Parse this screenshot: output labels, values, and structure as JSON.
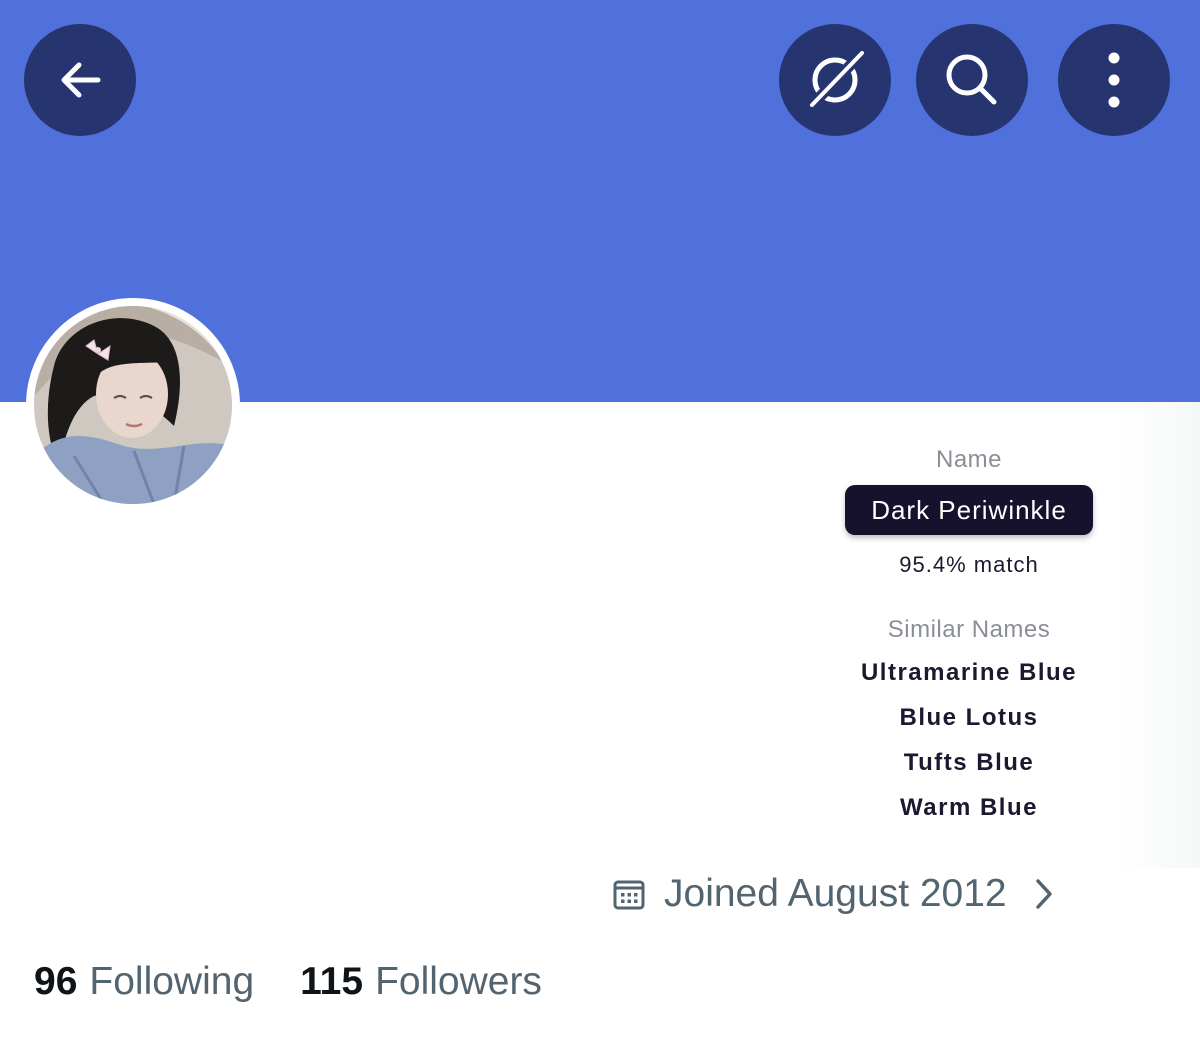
{
  "header": {
    "banner_color": "#5070dc",
    "button_color": "#263470",
    "buttons": [
      {
        "name": "back",
        "icon": "arrow-left-icon"
      },
      {
        "name": "grok",
        "icon": "grok-icon"
      },
      {
        "name": "search",
        "icon": "search-icon"
      },
      {
        "name": "more",
        "icon": "more-vertical-icon"
      }
    ]
  },
  "profile": {
    "avatar": "profile-photo"
  },
  "color_namer": {
    "name_label": "Name",
    "name_value": "Dark Periwinkle",
    "match_text": "95.4% match",
    "similar_label": "Similar Names",
    "similar_names": [
      "Ultramarine Blue",
      "Blue Lotus",
      "Tufts Blue",
      "Warm Blue"
    ]
  },
  "joined": {
    "icon": "calendar-icon",
    "text": "Joined August 2012"
  },
  "stats": {
    "following_count": "96",
    "following_label": "Following",
    "followers_count": "115",
    "followers_label": "Followers"
  }
}
